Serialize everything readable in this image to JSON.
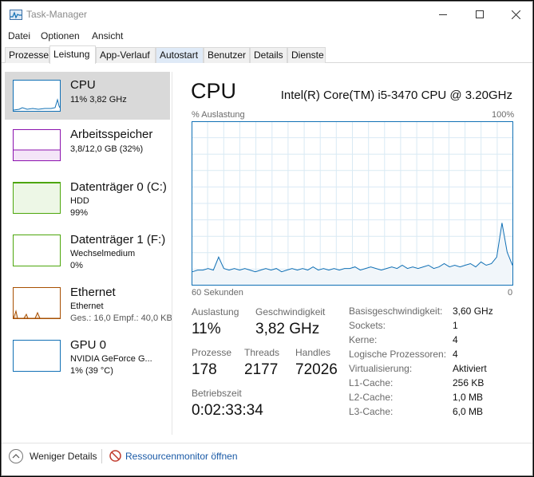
{
  "window": {
    "title": "Task-Manager"
  },
  "menu": [
    "Datei",
    "Optionen",
    "Ansicht"
  ],
  "tabs": [
    "Prozesse",
    "Leistung",
    "App-Verlauf",
    "Autostart",
    "Benutzer",
    "Details",
    "Dienste"
  ],
  "active_tab": "Leistung",
  "sidebar": [
    {
      "name": "CPU",
      "line1": "11% 3,82 GHz",
      "line2": "",
      "color": "#1170b5"
    },
    {
      "name": "Arbeitsspeicher",
      "line1": "3,8/12,0 GB (32%)",
      "line2": "",
      "color": "#8b12ae"
    },
    {
      "name": "Datenträger 0 (C:)",
      "line1": "HDD",
      "line2": "99%",
      "color": "#4da60c"
    },
    {
      "name": "Datenträger 1 (F:)",
      "line1": "Wechselmedium",
      "line2": "0%",
      "color": "#4da60c"
    },
    {
      "name": "Ethernet",
      "line1": "Ethernet",
      "line2": "Ges.: 16,0  Empf.: 40,0 KB",
      "color": "#a74f01"
    },
    {
      "name": "GPU 0",
      "line1": "NVIDIA GeForce G...",
      "line2": "1% (39 °C)",
      "color": "#1170b5"
    }
  ],
  "main": {
    "title": "CPU",
    "model": "Intel(R) Core(TM) i5-3470 CPU @ 3.20GHz",
    "graph_top_left": "% Auslastung",
    "graph_top_right": "100%",
    "graph_bottom_left": "60 Sekunden",
    "graph_bottom_right": "0"
  },
  "stats": {
    "auslastung_label": "Auslastung",
    "auslastung_value": "11%",
    "geschwindigkeit_label": "Geschwindigkeit",
    "geschwindigkeit_value": "3,82 GHz",
    "prozesse_label": "Prozesse",
    "prozesse_value": "178",
    "threads_label": "Threads",
    "threads_value": "2177",
    "handles_label": "Handles",
    "handles_value": "72026",
    "betriebszeit_label": "Betriebszeit",
    "betriebszeit_value": "0:02:33:34"
  },
  "info": [
    {
      "label": "Basisgeschwindigkeit:",
      "value": "3,60 GHz"
    },
    {
      "label": "Sockets:",
      "value": "1"
    },
    {
      "label": "Kerne:",
      "value": "4"
    },
    {
      "label": "Logische Prozessoren:",
      "value": "4"
    },
    {
      "label": "Virtualisierung:",
      "value": "Aktiviert"
    },
    {
      "label": "L1-Cache:",
      "value": "256 KB"
    },
    {
      "label": "L2-Cache:",
      "value": "1,0 MB"
    },
    {
      "label": "L3-Cache:",
      "value": "6,0 MB"
    }
  ],
  "footer": {
    "fewer_details": "Weniger Details",
    "resource_monitor": "Ressourcenmonitor öffnen"
  },
  "colors": {
    "cpu": "#1170b5",
    "cpu_fill": "#f1f6fa",
    "grid": "#d9eaf4",
    "memory": "#8b12ae",
    "disk": "#4da60c",
    "ethernet": "#a74f01",
    "link": "#1a5aa6",
    "selected_bg": "#d9d9d9"
  },
  "chart_data": {
    "type": "area",
    "x_range": [
      60,
      0
    ],
    "ylim": [
      0,
      100
    ],
    "values": [
      8,
      9,
      9,
      10,
      9,
      17,
      10,
      9,
      10,
      9,
      10,
      9,
      8,
      9,
      10,
      9,
      10,
      8,
      9,
      10,
      9,
      10,
      9,
      11,
      9,
      10,
      9,
      10,
      9,
      10,
      10,
      11,
      9,
      10,
      11,
      10,
      9,
      10,
      11,
      10,
      12,
      10,
      11,
      10,
      11,
      12,
      10,
      11,
      13,
      11,
      12,
      11,
      12,
      13,
      11,
      14,
      12,
      13,
      17,
      38,
      20,
      12
    ]
  }
}
